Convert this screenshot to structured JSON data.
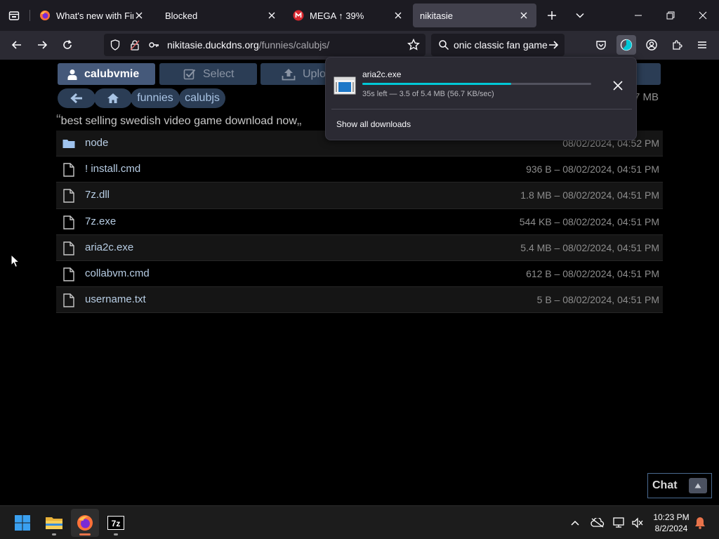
{
  "browser": {
    "tabs": [
      {
        "title": "What's new with Firefox",
        "icon": "firefox-icon",
        "active": false
      },
      {
        "title": "Blocked",
        "icon": "none",
        "active": false
      },
      {
        "title": "MEGA ↑ 39%",
        "icon": "mega-icon",
        "active": false
      },
      {
        "title": "nikitasie",
        "icon": "none",
        "active": true
      }
    ],
    "url_host": "nikitasie.duckdns.org",
    "url_path": "/funnies/calubjs/",
    "search_value": "onic classic fan game"
  },
  "page": {
    "user_button": "calubvmie",
    "select_button": "Select",
    "upload_button": "Uplo",
    "breadcrumbs": [
      "funnies",
      "calubjs"
    ],
    "total_size": "7 MB",
    "quote": "best selling swedish video game download now",
    "files": [
      {
        "name": "node",
        "meta": "08/02/2024, 04:52 PM",
        "type": "folder"
      },
      {
        "name": "! install.cmd",
        "meta": "936 B – 08/02/2024, 04:51 PM",
        "type": "file"
      },
      {
        "name": "7z.dll",
        "meta": "1.8 MB – 08/02/2024, 04:51 PM",
        "type": "file"
      },
      {
        "name": "7z.exe",
        "meta": "544 KB – 08/02/2024, 04:51 PM",
        "type": "file"
      },
      {
        "name": "aria2c.exe",
        "meta": "5.4 MB – 08/02/2024, 04:51 PM",
        "type": "file"
      },
      {
        "name": "collabvm.cmd",
        "meta": "612 B – 08/02/2024, 04:51 PM",
        "type": "file"
      },
      {
        "name": "username.txt",
        "meta": "5 B – 08/02/2024, 04:51 PM",
        "type": "file"
      }
    ],
    "chat_label": "Chat"
  },
  "downloads": {
    "file_name": "aria2c.exe",
    "status": "35s left — 3.5 of 5.4 MB (56.7 KB/sec)",
    "progress": 0.65,
    "show_all": "Show all downloads"
  },
  "taskbar": {
    "apps": [
      "windows-start-icon",
      "file-explorer-icon",
      "firefox-icon",
      "7zip-icon"
    ],
    "time": "10:23 PM",
    "date": "8/2/2024"
  },
  "colors": {
    "accent": "#00c8d7",
    "button_bg": "#2b3d55",
    "link": "#b7cde4"
  }
}
